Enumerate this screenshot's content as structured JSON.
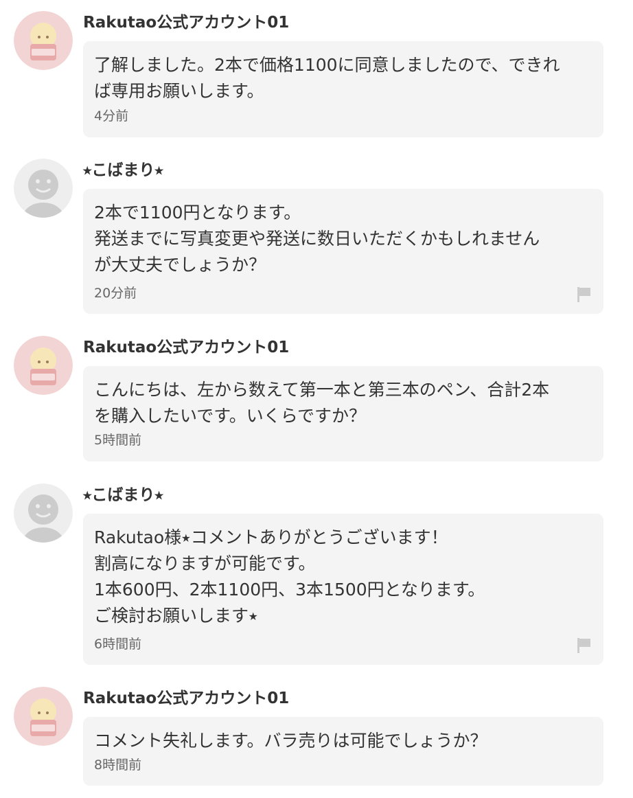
{
  "colors": {
    "bubble_bg": "#f4f4f4",
    "text": "#333333",
    "time_text": "#666666",
    "flag_icon": "#cccccc",
    "avatar_gray": "#dddddd",
    "avatar_pink": "#f3d4d4"
  },
  "comments": [
    {
      "author": "Rakutao公式アカウント01",
      "avatar": "rakutao-avatar",
      "lines": [
        "了解しました。2本で価格1100に同意しましたので、できれ",
        "ば専用お願いします。"
      ],
      "time": "4分前",
      "has_report_flag": false
    },
    {
      "author": "⭑こばまり⭑",
      "avatar": "default-user-avatar",
      "lines": [
        "2本で1100円となります。",
        "発送までに写真変更や発送に数日いただくかもしれません",
        "が大丈夫でしょうか？"
      ],
      "time": "20分前",
      "has_report_flag": true
    },
    {
      "author": "Rakutao公式アカウント01",
      "avatar": "rakutao-avatar",
      "lines": [
        "こんにちは、左から数えて第一本と第三本のペン、合計2本",
        "を購入したいです。いくらですか？"
      ],
      "time": "5時間前",
      "has_report_flag": false
    },
    {
      "author": "⭑こばまり⭑",
      "avatar": "default-user-avatar",
      "lines": [
        "Rakutao様⭑コメントありがとうございます！",
        "割高になりますが可能です。",
        "1本600円、2本1100円、3本1500円となります。",
        "ご検討お願いします⭑"
      ],
      "time": "6時間前",
      "has_report_flag": true
    },
    {
      "author": "Rakutao公式アカウント01",
      "avatar": "rakutao-avatar",
      "lines": [
        "コメント失礼します。バラ売りは可能でしょうか？"
      ],
      "time": "8時間前",
      "has_report_flag": false
    }
  ]
}
